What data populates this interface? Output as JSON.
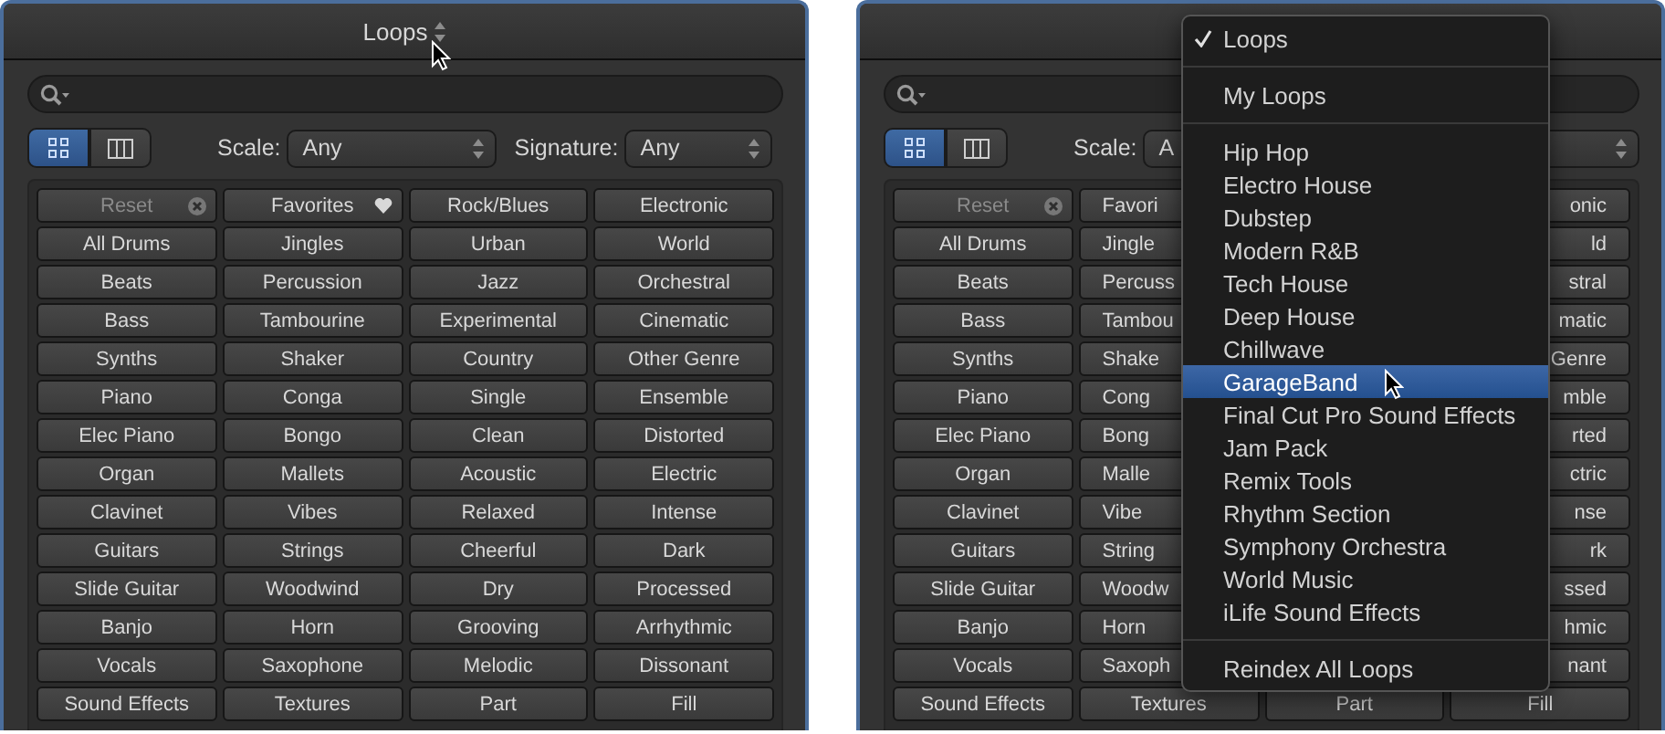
{
  "panels": [
    {
      "title": "Loops",
      "pointer": true,
      "search": {
        "kind": "search"
      },
      "view_buttons": [
        {
          "kind": "grid",
          "selected": true
        },
        {
          "kind": "columns",
          "selected": false
        }
      ],
      "filters": [
        {
          "label": "Scale:",
          "value": "Any"
        },
        {
          "label": "Signature:",
          "value": "Any"
        }
      ],
      "grid": [
        [
          {
            "text": "Reset",
            "disabled": true,
            "kind": "clearable"
          },
          {
            "text": "Favorites",
            "disabled": false,
            "kind": "favorites"
          },
          {
            "text": "Rock/Blues",
            "disabled": false
          },
          {
            "text": "Electronic",
            "disabled": false
          }
        ],
        [
          {
            "text": "All Drums",
            "disabled": false
          },
          {
            "text": "Jingles",
            "disabled": false
          },
          {
            "text": "Urban",
            "disabled": false
          },
          {
            "text": "World",
            "disabled": false
          }
        ],
        [
          {
            "text": "Beats",
            "disabled": false
          },
          {
            "text": "Percussion",
            "disabled": false
          },
          {
            "text": "Jazz",
            "disabled": false
          },
          {
            "text": "Orchestral",
            "disabled": false
          }
        ],
        [
          {
            "text": "Bass",
            "disabled": false
          },
          {
            "text": "Tambourine",
            "disabled": false
          },
          {
            "text": "Experimental",
            "disabled": false
          },
          {
            "text": "Cinematic",
            "disabled": false
          }
        ],
        [
          {
            "text": "Synths",
            "disabled": false
          },
          {
            "text": "Shaker",
            "disabled": false
          },
          {
            "text": "Country",
            "disabled": false
          },
          {
            "text": "Other Genre",
            "disabled": false
          }
        ],
        [
          {
            "text": "Piano",
            "disabled": false
          },
          {
            "text": "Conga",
            "disabled": false
          },
          {
            "text": "Single",
            "disabled": false
          },
          {
            "text": "Ensemble",
            "disabled": false
          }
        ],
        [
          {
            "text": "Elec Piano",
            "disabled": false
          },
          {
            "text": "Bongo",
            "disabled": false
          },
          {
            "text": "Clean",
            "disabled": false
          },
          {
            "text": "Distorted",
            "disabled": false
          }
        ],
        [
          {
            "text": "Organ",
            "disabled": false
          },
          {
            "text": "Mallets",
            "disabled": false
          },
          {
            "text": "Acoustic",
            "disabled": false
          },
          {
            "text": "Electric",
            "disabled": false
          }
        ],
        [
          {
            "text": "Clavinet",
            "disabled": false
          },
          {
            "text": "Vibes",
            "disabled": false
          },
          {
            "text": "Relaxed",
            "disabled": false
          },
          {
            "text": "Intense",
            "disabled": false
          }
        ],
        [
          {
            "text": "Guitars",
            "disabled": false
          },
          {
            "text": "Strings",
            "disabled": false
          },
          {
            "text": "Cheerful",
            "disabled": false
          },
          {
            "text": "Dark",
            "disabled": false
          }
        ],
        [
          {
            "text": "Slide Guitar",
            "disabled": false
          },
          {
            "text": "Woodwind",
            "disabled": false
          },
          {
            "text": "Dry",
            "disabled": false
          },
          {
            "text": "Processed",
            "disabled": false
          }
        ],
        [
          {
            "text": "Banjo",
            "disabled": false
          },
          {
            "text": "Horn",
            "disabled": false
          },
          {
            "text": "Grooving",
            "disabled": false
          },
          {
            "text": "Arrhythmic",
            "disabled": false
          }
        ],
        [
          {
            "text": "Vocals",
            "disabled": false
          },
          {
            "text": "Saxophone",
            "disabled": false
          },
          {
            "text": "Melodic",
            "disabled": false
          },
          {
            "text": "Dissonant",
            "disabled": false
          }
        ],
        [
          {
            "text": "Sound Effects",
            "disabled": false
          },
          {
            "text": "Textures",
            "disabled": false
          },
          {
            "text": "Part",
            "disabled": false
          },
          {
            "text": "Fill",
            "disabled": false
          }
        ]
      ]
    },
    {
      "search": {
        "kind": "search"
      },
      "view_buttons": [
        {
          "kind": "grid",
          "selected": true
        },
        {
          "kind": "columns",
          "selected": false
        }
      ],
      "filters": [
        {
          "label": "Scale:",
          "value": "A"
        }
      ],
      "grid": [
        [
          {
            "text": "Reset",
            "disabled": true,
            "kind": "clearable"
          },
          {
            "text": "Favori",
            "disabled": false
          },
          {
            "text": "onic",
            "disabled": false
          }
        ],
        [
          {
            "text": "All Drums",
            "disabled": false
          },
          {
            "text": "Jingle",
            "disabled": false
          },
          {
            "text": "ld",
            "disabled": false
          }
        ],
        [
          {
            "text": "Beats",
            "disabled": false
          },
          {
            "text": "Percuss",
            "disabled": false
          },
          {
            "text": "stral",
            "disabled": false
          }
        ],
        [
          {
            "text": "Bass",
            "disabled": false
          },
          {
            "text": "Tambou",
            "disabled": false
          },
          {
            "text": "matic",
            "disabled": false
          }
        ],
        [
          {
            "text": "Synths",
            "disabled": false
          },
          {
            "text": "Shake",
            "disabled": false
          },
          {
            "text": "Genre",
            "disabled": false
          }
        ],
        [
          {
            "text": "Piano",
            "disabled": false
          },
          {
            "text": "Cong",
            "disabled": false
          },
          {
            "text": "mble",
            "disabled": false
          }
        ],
        [
          {
            "text": "Elec Piano",
            "disabled": false
          },
          {
            "text": "Bong",
            "disabled": false
          },
          {
            "text": "rted",
            "disabled": false
          }
        ],
        [
          {
            "text": "Organ",
            "disabled": false
          },
          {
            "text": "Malle",
            "disabled": false
          },
          {
            "text": "ctric",
            "disabled": false
          }
        ],
        [
          {
            "text": "Clavinet",
            "disabled": false
          },
          {
            "text": "Vibe",
            "disabled": false
          },
          {
            "text": "nse",
            "disabled": false
          }
        ],
        [
          {
            "text": "Guitars",
            "disabled": false
          },
          {
            "text": "String",
            "disabled": false
          },
          {
            "text": "rk",
            "disabled": false
          }
        ],
        [
          {
            "text": "Slide Guitar",
            "disabled": false
          },
          {
            "text": "Woodw",
            "disabled": false
          },
          {
            "text": "ssed",
            "disabled": false
          }
        ],
        [
          {
            "text": "Banjo",
            "disabled": false
          },
          {
            "text": "Horn",
            "disabled": false
          },
          {
            "text": "hmic",
            "disabled": false
          }
        ],
        [
          {
            "text": "Vocals",
            "disabled": false
          },
          {
            "text": "Saxoph",
            "disabled": false
          },
          {
            "text": "nant",
            "disabled": false
          }
        ],
        [
          {
            "text": "Sound Effects",
            "disabled": false
          },
          {
            "text": "Textures",
            "disabled": false
          },
          {
            "text": "Part",
            "disabled": false
          },
          {
            "text": "Fill",
            "disabled": false
          }
        ]
      ],
      "menu": {
        "sections": [
          [
            {
              "text": "Loops",
              "checked": true,
              "selected": false
            }
          ],
          [
            {
              "text": "My Loops",
              "checked": false,
              "selected": false
            }
          ],
          [
            {
              "text": "Hip Hop",
              "checked": false,
              "selected": false
            },
            {
              "text": "Electro House",
              "checked": false,
              "selected": false
            },
            {
              "text": "Dubstep",
              "checked": false,
              "selected": false
            },
            {
              "text": "Modern R&B",
              "checked": false,
              "selected": false
            },
            {
              "text": "Tech House",
              "checked": false,
              "selected": false
            },
            {
              "text": "Deep House",
              "checked": false,
              "selected": false
            },
            {
              "text": "Chillwave",
              "checked": false,
              "selected": false
            },
            {
              "text": "GarageBand",
              "checked": false,
              "selected": true,
              "pointer": true
            },
            {
              "text": "Final Cut Pro Sound Effects",
              "checked": false,
              "selected": false
            },
            {
              "text": "Jam Pack",
              "checked": false,
              "selected": false
            },
            {
              "text": "Remix Tools",
              "checked": false,
              "selected": false
            },
            {
              "text": "Rhythm Section",
              "checked": false,
              "selected": false
            },
            {
              "text": "Symphony Orchestra",
              "checked": false,
              "selected": false
            },
            {
              "text": "World Music",
              "checked": false,
              "selected": false
            },
            {
              "text": "iLife Sound Effects",
              "checked": false,
              "selected": false
            }
          ],
          [
            {
              "text": "Reindex All Loops",
              "checked": false,
              "selected": false
            }
          ]
        ]
      }
    }
  ]
}
